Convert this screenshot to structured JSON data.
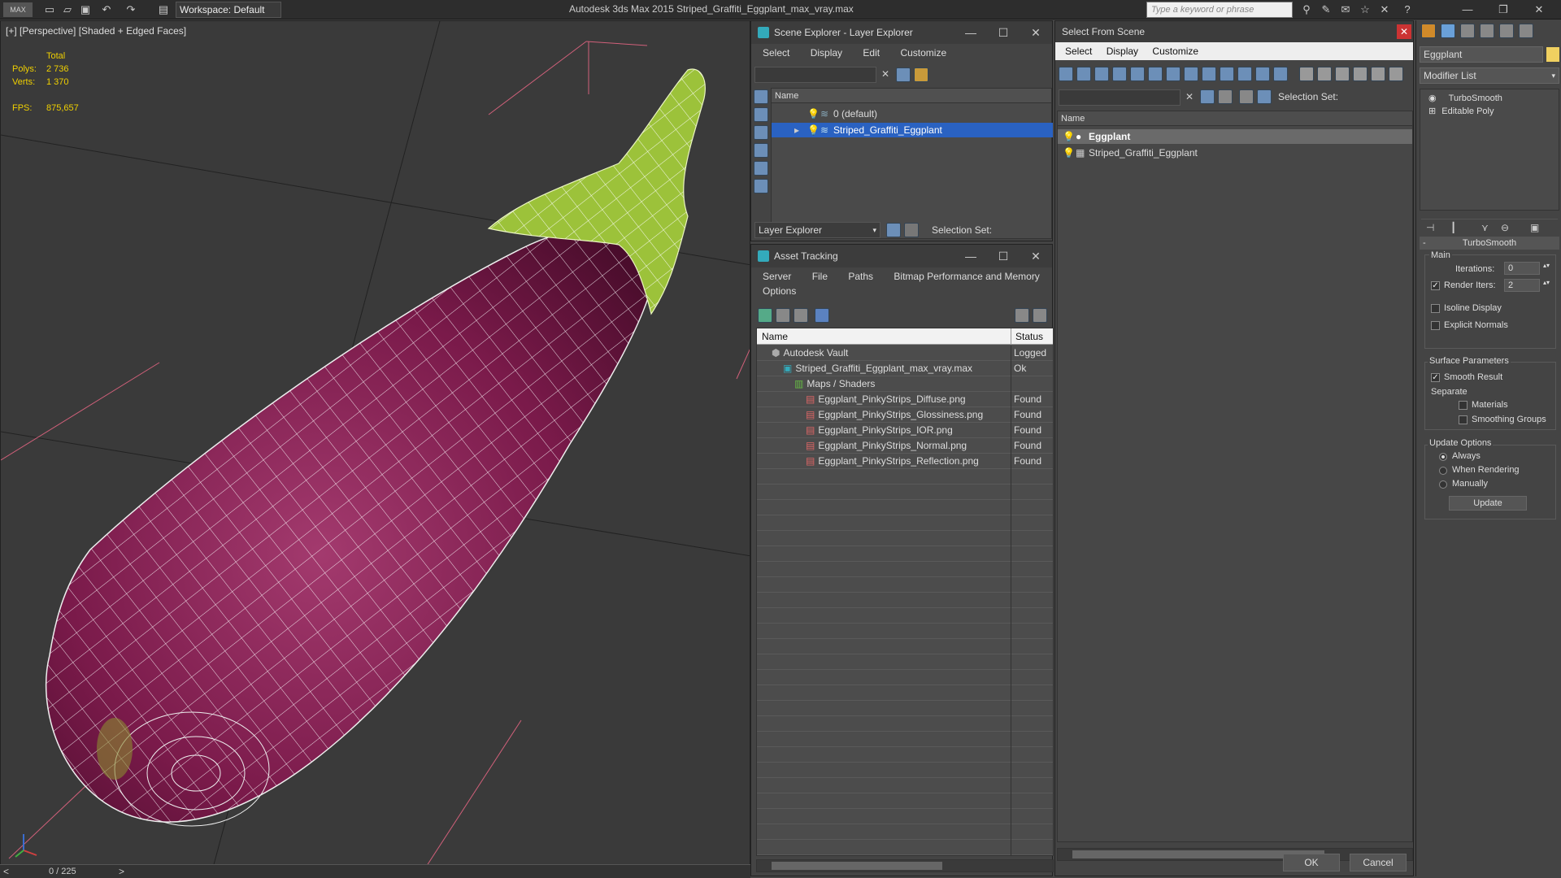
{
  "app": {
    "title": "Autodesk 3ds Max  2015    Striped_Graffiti_Eggplant_max_vray.max",
    "workspace": "Workspace: Default",
    "search_placeholder": "Type a keyword or phrase"
  },
  "viewport": {
    "label": "[+] [Perspective] [Shaded + Edged Faces]",
    "stats": {
      "total_label": "Total",
      "polys_label": "Polys:",
      "polys_value": "2 736",
      "verts_label": "Verts:",
      "verts_value": "1 370",
      "fps_label": "FPS:",
      "fps_value": "875,657"
    },
    "timeline": "0 / 225"
  },
  "scene_explorer": {
    "title": "Scene Explorer - Layer Explorer",
    "menu": [
      "Select",
      "Display",
      "Edit",
      "Customize"
    ],
    "column": "Name",
    "rows": [
      {
        "label": "0 (default)",
        "selected": false
      },
      {
        "label": "Striped_Graffiti_Eggplant",
        "selected": true
      }
    ],
    "footer_dropdown": "Layer Explorer",
    "selection_set_label": "Selection Set:"
  },
  "asset_tracking": {
    "title": "Asset Tracking",
    "menu": [
      "Server",
      "File",
      "Paths",
      "Bitmap Performance and Memory"
    ],
    "menu2": [
      "Options"
    ],
    "columns": [
      "Name",
      "Status"
    ],
    "rows": [
      {
        "name": "Autodesk Vault",
        "status": "Logged",
        "indent": 0
      },
      {
        "name": "Striped_Graffiti_Eggplant_max_vray.max",
        "status": "Ok",
        "indent": 1
      },
      {
        "name": "Maps / Shaders",
        "status": "",
        "indent": 2
      },
      {
        "name": "Eggplant_PinkyStrips_Diffuse.png",
        "status": "Found",
        "indent": 3
      },
      {
        "name": "Eggplant_PinkyStrips_Glossiness.png",
        "status": "Found",
        "indent": 3
      },
      {
        "name": "Eggplant_PinkyStrips_IOR.png",
        "status": "Found",
        "indent": 3
      },
      {
        "name": "Eggplant_PinkyStrips_Normal.png",
        "status": "Found",
        "indent": 3
      },
      {
        "name": "Eggplant_PinkyStrips_Reflection.png",
        "status": "Found",
        "indent": 3
      }
    ]
  },
  "select_from_scene": {
    "title": "Select From Scene",
    "menu": [
      "Select",
      "Display",
      "Customize"
    ],
    "selection_set_label": "Selection Set:",
    "column": "Name",
    "rows": [
      {
        "label": "Eggplant",
        "selected": true
      },
      {
        "label": "Striped_Graffiti_Eggplant",
        "selected": false
      }
    ],
    "ok": "OK",
    "cancel": "Cancel"
  },
  "command_panel": {
    "object_name": "Eggplant",
    "modifier_list": "Modifier List",
    "stack": [
      "TurboSmooth",
      "Editable Poly"
    ],
    "rollout_title": "TurboSmooth",
    "main_label": "Main",
    "iterations_label": "Iterations:",
    "iterations_value": "0",
    "render_iters_label": "Render Iters:",
    "render_iters_value": "2",
    "isoline_label": "Isoline Display",
    "explicit_normals_label": "Explicit Normals",
    "surface_params_label": "Surface Parameters",
    "smooth_result_label": "Smooth Result",
    "separate_label": "Separate",
    "materials_label": "Materials",
    "smoothing_groups_label": "Smoothing Groups",
    "update_options_label": "Update Options",
    "always_label": "Always",
    "when_rendering_label": "When Rendering",
    "manually_label": "Manually",
    "update_button": "Update"
  },
  "colors": {
    "selection": "#2a62c2",
    "eggplant": "#7a1a4a",
    "stem": "#9cc23a",
    "stats_text": "#f0d000"
  }
}
